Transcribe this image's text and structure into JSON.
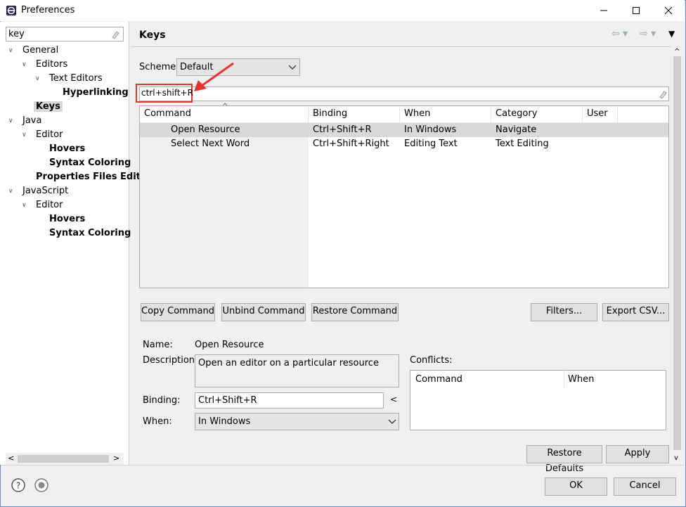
{
  "window": {
    "title": "Preferences",
    "minimize_label": "—",
    "maximize_label": "☐",
    "close_label": "✕"
  },
  "sidebar": {
    "filter_value": "key",
    "tree": [
      {
        "label": "General",
        "bold": false,
        "level": 0,
        "expanded": true
      },
      {
        "label": "Editors",
        "bold": false,
        "level": 1,
        "expanded": true
      },
      {
        "label": "Text Editors",
        "bold": false,
        "level": 2,
        "expanded": true
      },
      {
        "label": "Hyperlinking",
        "bold": true,
        "level": 3
      },
      {
        "label": "Keys",
        "bold": true,
        "level": 1,
        "selected": true
      },
      {
        "label": "Java",
        "bold": false,
        "level": 0,
        "expanded": true
      },
      {
        "label": "Editor",
        "bold": false,
        "level": 1,
        "expanded": true
      },
      {
        "label": "Hovers",
        "bold": true,
        "level": 2
      },
      {
        "label": "Syntax Coloring",
        "bold": true,
        "level": 2
      },
      {
        "label": "Properties Files Edit",
        "bold": true,
        "level": 1
      },
      {
        "label": "JavaScript",
        "bold": false,
        "level": 0,
        "expanded": true
      },
      {
        "label": "Editor",
        "bold": false,
        "level": 1,
        "expanded": true
      },
      {
        "label": "Hovers",
        "bold": true,
        "level": 2
      },
      {
        "label": "Syntax Coloring",
        "bold": true,
        "level": 2
      }
    ]
  },
  "page": {
    "title": "Keys",
    "scheme_label": "Scheme:",
    "scheme_value": "Default",
    "filter_value": "ctrl+shift+R"
  },
  "table": {
    "columns": [
      "Command",
      "Binding",
      "When",
      "Category",
      "User"
    ],
    "rows": [
      {
        "command": "Open Resource",
        "binding": "Ctrl+Shift+R",
        "when": "In Windows",
        "category": "Navigate",
        "user": ""
      },
      {
        "command": "Select Next Word",
        "binding": "Ctrl+Shift+Right",
        "when": "Editing Text",
        "category": "Text Editing",
        "user": ""
      }
    ]
  },
  "buttons": {
    "copy": "Copy Command",
    "unbind": "Unbind Command",
    "restore": "Restore Command",
    "filters": "Filters...",
    "export": "Export CSV...",
    "restore_defaults": "Restore Defaults",
    "apply": "Apply",
    "ok": "OK",
    "cancel": "Cancel"
  },
  "details": {
    "name_label": "Name:",
    "name_value": "Open Resource",
    "description_label": "Description:",
    "description_value": "Open an editor on a particular resource",
    "binding_label": "Binding:",
    "binding_value": "Ctrl+Shift+R",
    "when_label": "When:",
    "when_value": "In Windows",
    "conflicts_label": "Conflicts:",
    "conflicts_columns": [
      "Command",
      "When"
    ]
  },
  "colors": {
    "annotation_red": "#e8322f",
    "selected_row": "#d9d9d9"
  }
}
